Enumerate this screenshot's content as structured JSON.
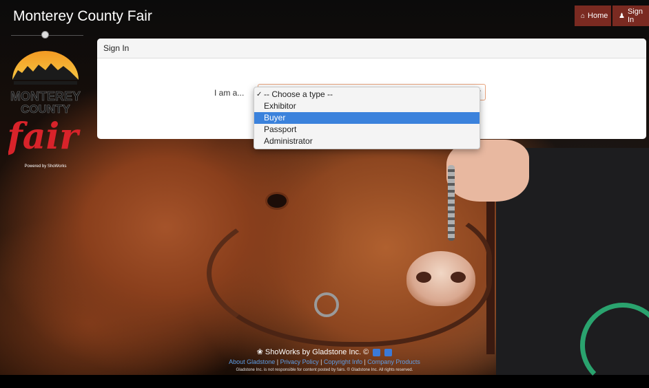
{
  "header": {
    "title": "Monterey County Fair",
    "nav": [
      {
        "label": "Home",
        "icon": "home-icon"
      },
      {
        "label": "Sign In",
        "icon": "user-icon"
      }
    ]
  },
  "sidebar": {
    "logo_text": [
      "MONTEREY",
      "COUNTY",
      "fair"
    ],
    "powered_by": "Powered by ShoWorks"
  },
  "panel": {
    "title": "Sign In",
    "role_label": "I am a...",
    "role_options": [
      {
        "label": "-- Choose a type --",
        "checked": true,
        "highlighted": false
      },
      {
        "label": "Exhibitor",
        "checked": false,
        "highlighted": false
      },
      {
        "label": "Buyer",
        "checked": false,
        "highlighted": true
      },
      {
        "label": "Passport",
        "checked": false,
        "highlighted": false
      },
      {
        "label": "Administrator",
        "checked": false,
        "highlighted": false
      }
    ]
  },
  "footer": {
    "brand": "ShoWorks by Gladstone Inc. ©",
    "links": [
      "About Gladstone",
      "Privacy Policy",
      "Copyright Info",
      "Company Products"
    ],
    "note": "Gladstone Inc. is not responsible for content posted by fairs. © Gladstone Inc. All rights reserved.",
    "colors": {
      "link": "#5d9ee6",
      "accent": "#7a2a21",
      "highlight": "#3b82dc"
    }
  }
}
